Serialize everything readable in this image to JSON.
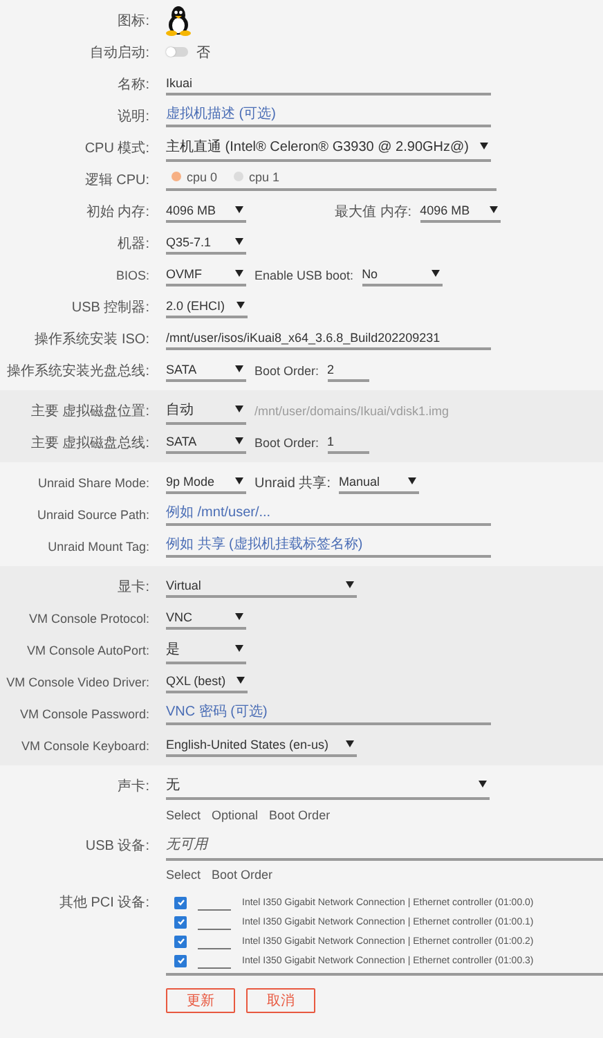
{
  "sections": [
    {
      "rows": [
        {
          "label": "图标:",
          "items": [
            {
              "kind": "os_icon"
            }
          ]
        },
        {
          "label": "自动启动:",
          "items": [
            {
              "kind": "toggle",
              "on": false,
              "text": "否"
            }
          ]
        },
        {
          "label": "名称:",
          "items": [
            {
              "kind": "field",
              "value": "Ikuai"
            }
          ]
        },
        {
          "label": "说明:",
          "items": [
            {
              "kind": "field",
              "placeholder": "虚拟机描述 (可选)"
            }
          ]
        },
        {
          "label": "CPU 模式:",
          "items": [
            {
              "kind": "long_select",
              "value": "主机直通 (Intel® Celeron® G3930 @ 2.90GHz@)"
            }
          ]
        },
        {
          "label": "逻辑 CPU:",
          "items": [
            {
              "kind": "radios",
              "options": [
                {
                  "label": "cpu 0",
                  "selected": true
                },
                {
                  "label": "cpu 1",
                  "selected": false
                }
              ]
            }
          ]
        },
        {
          "label": "初始 内存:",
          "items": [
            {
              "kind": "select",
              "value": "4096 MB"
            },
            {
              "kind": "side_label",
              "text": "最大值 内存:"
            },
            {
              "kind": "select",
              "value": "4096 MB"
            }
          ]
        },
        {
          "label": "机器:",
          "items": [
            {
              "kind": "select",
              "value": "Q35-7.1"
            }
          ]
        },
        {
          "label": "BIOS:",
          "items": [
            {
              "kind": "select",
              "value": "OVMF"
            },
            {
              "kind": "text",
              "text": "Enable USB boot:",
              "disabled": false
            },
            {
              "kind": "select",
              "value": "No"
            }
          ]
        },
        {
          "label": "USB 控制器:",
          "items": [
            {
              "kind": "select",
              "value": "2.0 (EHCI)"
            }
          ]
        },
        {
          "label": "操作系统安装 ISO:",
          "items": [
            {
              "kind": "field",
              "value": "/mnt/user/isos/iKuai8_x64_3.6.8_Build202209231"
            }
          ]
        },
        {
          "label": "操作系统安装光盘总线:",
          "items": [
            {
              "kind": "select",
              "value": "SATA"
            },
            {
              "kind": "text",
              "text": "Boot Order:",
              "disabled": false
            },
            {
              "kind": "short_field",
              "value": "2"
            }
          ]
        }
      ]
    },
    {
      "rows": [
        {
          "label": "主要 虚拟磁盘位置:",
          "items": [
            {
              "kind": "select",
              "value": "自动"
            },
            {
              "kind": "text",
              "text": "/mnt/user/domains/Ikuai/vdisk1.img",
              "disabled": true
            }
          ]
        },
        {
          "label": "主要 虚拟磁盘总线:",
          "items": [
            {
              "kind": "select",
              "value": "SATA"
            },
            {
              "kind": "text",
              "text": "Boot Order:",
              "disabled": false
            },
            {
              "kind": "short_field",
              "value": "1"
            }
          ]
        }
      ]
    },
    {
      "rows": [
        {
          "label": "Unraid Share Mode:",
          "items": [
            {
              "kind": "select",
              "value": "9p Mode"
            },
            {
              "kind": "text",
              "text": "Unraid 共享:",
              "disabled": false
            },
            {
              "kind": "select",
              "value": "Manual"
            }
          ]
        },
        {
          "label": "Unraid Source Path:",
          "items": [
            {
              "kind": "field",
              "placeholder": "例如 /mnt/user/..."
            }
          ]
        },
        {
          "label": "Unraid Mount Tag:",
          "items": [
            {
              "kind": "field",
              "placeholder": "例如 共享 (虚拟机挂载标签名称)"
            }
          ]
        }
      ]
    },
    {
      "rows": [
        {
          "label": "显卡:",
          "items": [
            {
              "kind": "wide_select",
              "value": "Virtual"
            }
          ]
        },
        {
          "label": "VM Console Protocol:",
          "items": [
            {
              "kind": "select",
              "value": "VNC"
            }
          ]
        },
        {
          "label": "VM Console AutoPort:",
          "items": [
            {
              "kind": "select",
              "value": "是"
            }
          ]
        },
        {
          "label": "VM Console Video Driver:",
          "items": [
            {
              "kind": "select",
              "value": "QXL (best)"
            }
          ]
        },
        {
          "label": "VM Console Password:",
          "items": [
            {
              "kind": "field",
              "placeholder": "VNC 密码 (可选)"
            }
          ]
        },
        {
          "label": "VM Console Keyboard:",
          "items": [
            {
              "kind": "wide_select",
              "value": "English-United States (en-us)"
            }
          ]
        }
      ]
    },
    {
      "rows": [
        {
          "label": "声卡:",
          "items": [
            {
              "kind": "long_select",
              "value": "无"
            }
          ]
        },
        {
          "items": [
            {
              "kind": "header",
              "text": "Select"
            },
            {
              "kind": "header",
              "text": "Optional"
            },
            {
              "kind": "header",
              "text": "Boot Order"
            }
          ]
        },
        {
          "label": "USB 设备:",
          "items": [
            {
              "kind": "empty_list",
              "text": "无可用"
            }
          ]
        },
        {
          "items": [
            {
              "kind": "header",
              "text": "Select"
            },
            {
              "kind": "header",
              "text": "Boot Order"
            }
          ]
        },
        {
          "label": "其他 PCI 设备:",
          "items": [
            {
              "kind": "device_list",
              "devices": [
                {
                  "checked": true,
                  "name": "Intel I350 Gigabit Network Connection | Ethernet controller (01:00.0)"
                },
                {
                  "checked": true,
                  "name": "Intel I350 Gigabit Network Connection | Ethernet controller (01:00.1)"
                },
                {
                  "checked": true,
                  "name": "Intel I350 Gigabit Network Connection | Ethernet controller (01:00.2)"
                },
                {
                  "checked": true,
                  "name": "Intel I350 Gigabit Network Connection | Ethernet controller (01:00.3)"
                }
              ]
            }
          ]
        }
      ]
    }
  ],
  "buttons": [
    "更新",
    "取消"
  ]
}
